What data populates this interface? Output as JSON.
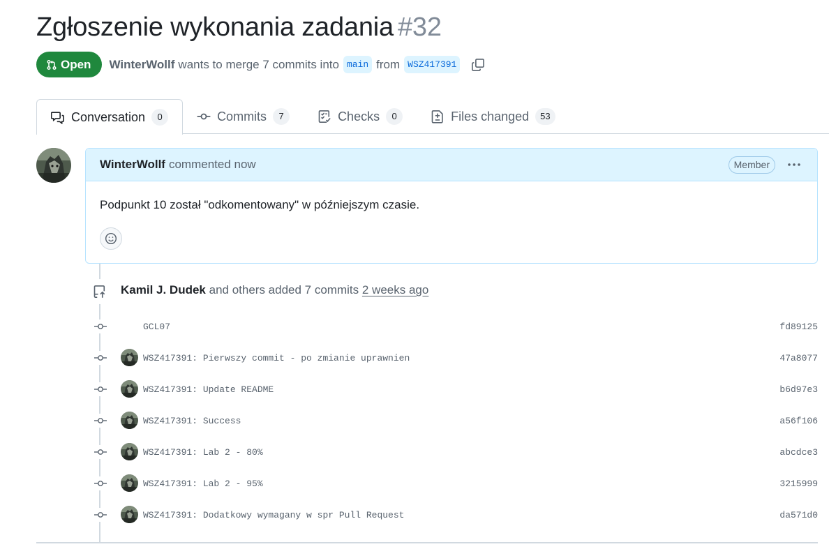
{
  "pr": {
    "title": "Zgłoszenie wykonania zadania",
    "number": "#32",
    "state": "Open",
    "author": "WinterWollf",
    "action": "wants to merge 7 commits into",
    "base_branch": "main",
    "from_word": "from",
    "head_branch": "WSZ417391"
  },
  "tabs": [
    {
      "label": "Conversation",
      "count": "0",
      "icon": "comment-discussion-icon"
    },
    {
      "label": "Commits",
      "count": "7",
      "icon": "git-commit-icon"
    },
    {
      "label": "Checks",
      "count": "0",
      "icon": "checklist-icon"
    },
    {
      "label": "Files changed",
      "count": "53",
      "icon": "file-diff-icon"
    }
  ],
  "comment": {
    "author": "WinterWollf",
    "when": "commented now",
    "role": "Member",
    "body": "Podpunkt 10 został \"odkomentowany\" w późniejszym czasie."
  },
  "push": {
    "author": "Kamil J. Dudek",
    "text": "and others added 7 commits",
    "when": "2 weeks ago"
  },
  "commits": [
    {
      "message": "GCL07",
      "sha": "fd89125",
      "avatar": false
    },
    {
      "message": "WSZ417391: Pierwszy commit - po zmianie uprawnien",
      "sha": "47a8077",
      "avatar": true
    },
    {
      "message": "WSZ417391: Update README",
      "sha": "b6d97e3",
      "avatar": true
    },
    {
      "message": "WSZ417391: Success",
      "sha": "a56f106",
      "avatar": true
    },
    {
      "message": "WSZ417391: Lab 2 - 80%",
      "sha": "abcdce3",
      "avatar": true
    },
    {
      "message": "WSZ417391: Lab 2 - 95%",
      "sha": "3215999",
      "avatar": true
    },
    {
      "message": "WSZ417391: Dodatkowy wymagany w spr Pull Request",
      "sha": "da571d0",
      "avatar": true
    }
  ],
  "colors": {
    "open_green": "#1f883d",
    "link_blue": "#0969da",
    "comment_header_bg": "#ddf4ff",
    "muted": "#59636e"
  }
}
